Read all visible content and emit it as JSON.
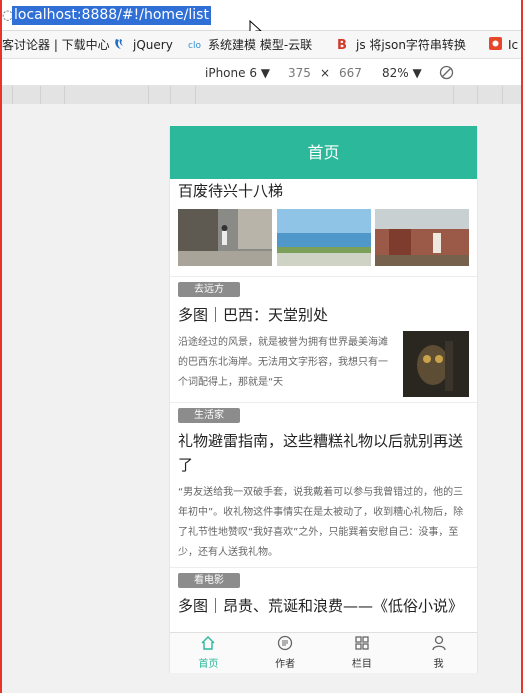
{
  "browser": {
    "url": "localhost:8888/#!/home/list",
    "bookmarks": [
      {
        "label": "客讨论器 | 下载中心",
        "icon": "page-icon"
      },
      {
        "label": "jQuery",
        "icon": "jquery-icon"
      },
      {
        "label": "系统建模 模型-云联",
        "icon": "clo-icon"
      },
      {
        "label": "js 将json字符串转换",
        "icon": "b-icon"
      },
      {
        "label": "Ic",
        "icon": "red-square-icon"
      }
    ],
    "device": {
      "name": "iPhone 6",
      "width": "375",
      "times": "×",
      "height": "667",
      "zoom": "82%"
    }
  },
  "app": {
    "header_title": "首页",
    "accent_color": "#2bb89b",
    "articles": [
      {
        "title": "百废待兴十八梯",
        "type": "three-images"
      },
      {
        "tag": "去远方",
        "title": "多图｜巴西：天堂别处",
        "excerpt": "沿途经过的风景，就是被誉为拥有世界最美海滩的巴西东北海岸。无法用文字形容，我想只有一个词配得上，那就是“天"
      },
      {
        "tag": "生活家",
        "title": "礼物避雷指南，这些糟糕礼物以后就别再送了",
        "excerpt": "“男友送给我一双破手套，说我戴着可以参与我曾错过的，他的三年初中”。收礼物这件事情实在是太被动了，收到糟心礼物后，除了礼节性地赞叹“我好喜欢”之外，只能巽着安慰自己：没事，至少，还有人送我礼物。"
      },
      {
        "tag": "看电影",
        "title": "多图｜昂贵、荒诞和浪费——《低俗小说》"
      }
    ],
    "tabs": [
      {
        "label": "首页",
        "icon": "home-icon",
        "active": true
      },
      {
        "label": "作者",
        "icon": "author-icon",
        "active": false
      },
      {
        "label": "栏目",
        "icon": "grid-icon",
        "active": false
      },
      {
        "label": "我",
        "icon": "user-icon",
        "active": false
      }
    ]
  }
}
